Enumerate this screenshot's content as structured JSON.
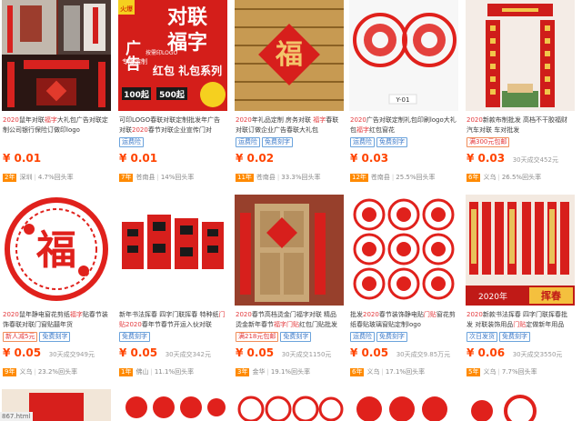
{
  "status_url": "867.html",
  "products": [
    {
      "title_parts": [
        [
          "2020",
          "hl"
        ],
        [
          "鼠年对联",
          ""
        ],
        [
          "福字",
          "hl"
        ],
        [
          "大礼包广告对联定制公司银行保险订做印logo",
          ""
        ]
      ],
      "badges": [],
      "price": "¥ 0.01",
      "sales": "",
      "years": "2年",
      "location": "深圳",
      "rate": "4.7%回头率"
    },
    {
      "title_parts": [
        [
          "可印LOGO春联对联定制批发年广告对联",
          ""
        ],
        [
          "2020",
          "hl"
        ],
        [
          "春节对联企业宣传门对",
          ""
        ]
      ],
      "badges": [
        [
          "运费险",
          "blue"
        ]
      ],
      "price": "¥ 0.01",
      "sales": "",
      "years": "7年",
      "location": "苍南县",
      "rate": "14%回头率"
    },
    {
      "title_parts": [
        [
          "2020",
          "hl"
        ],
        [
          "年礼品定制 房务对联 ",
          ""
        ],
        [
          "福字",
          "hl"
        ],
        [
          "春联对联订做企业广告春联大礼包",
          ""
        ]
      ],
      "badges": [
        [
          "运费险",
          "blue"
        ],
        [
          "免费刻字",
          "blue"
        ]
      ],
      "price": "¥ 0.02",
      "sales": "",
      "years": "11年",
      "location": "苍南县",
      "rate": "33.3%回头率"
    },
    {
      "title_parts": [
        [
          "2020",
          "hl"
        ],
        [
          "广告对联定制礼包印刷logo大礼包",
          ""
        ],
        [
          "福字",
          "hl"
        ],
        [
          "红包窗花",
          ""
        ]
      ],
      "badges": [
        [
          "运费险",
          "blue"
        ],
        [
          "免费刻字",
          "blue"
        ]
      ],
      "price": "¥ 0.03",
      "sales": "",
      "years": "12年",
      "location": "苍南县",
      "rate": "25.5%回头率"
    },
    {
      "title_parts": [
        [
          "2020",
          "hl"
        ],
        [
          "新款布制批发 高档不干胶福财汽车对联 车对批发",
          ""
        ]
      ],
      "badges": [
        [
          "满300元包邮",
          "red"
        ]
      ],
      "price": "¥ 0.03",
      "sales": "30天成交452元",
      "years": "6年",
      "location": "义乌",
      "rate": "26.5%回头率"
    },
    {
      "title_parts": [
        [
          "2020",
          "hl"
        ],
        [
          "鼠年静电窗花剪纸",
          ""
        ],
        [
          "福字",
          "hl"
        ],
        [
          "贴春节装饰春联对联门窗贴囍年货",
          ""
        ]
      ],
      "badges": [
        [
          "新人减5元",
          "red"
        ],
        [
          "免费刻字",
          "blue"
        ]
      ],
      "price": "¥ 0.05",
      "sales": "30天成交949元",
      "years": "9年",
      "location": "义乌",
      "rate": "23.2%回头率"
    },
    {
      "title_parts": [
        [
          "新年书法挥春 四字门联挥春 特种纸",
          ""
        ],
        [
          "门贴",
          "hl"
        ],
        [
          "2020",
          "hl"
        ],
        [
          "春年节春节开运入伙对联",
          ""
        ]
      ],
      "badges": [
        [
          "免费刻字",
          "blue"
        ]
      ],
      "price": "¥ 0.05",
      "sales": "30天成交342元",
      "years": "1年",
      "location": "佛山",
      "rate": "11.1%回头率"
    },
    {
      "title_parts": [
        [
          "2020",
          "hl"
        ],
        [
          "春节高档烫金门福字对联 精品烫金新年春节",
          ""
        ],
        [
          "福字门贴",
          "hl"
        ],
        [
          "红包门贴批发",
          ""
        ]
      ],
      "badges": [
        [
          "满218元包邮",
          "red"
        ],
        [
          "免费刻字",
          "blue"
        ]
      ],
      "price": "¥ 0.05",
      "sales": "30天成交1150元",
      "years": "3年",
      "location": "金华",
      "rate": "19.1%回头率"
    },
    {
      "title_parts": [
        [
          "批发",
          ""
        ],
        [
          "2020",
          "hl"
        ],
        [
          "春节装饰静电贴",
          ""
        ],
        [
          "门贴",
          "hl"
        ],
        [
          "窗花剪纸春贴玻璃窗贴定制logo",
          ""
        ]
      ],
      "badges": [
        [
          "运费险",
          "blue"
        ],
        [
          "免费刻字",
          "blue"
        ]
      ],
      "price": "¥ 0.05",
      "sales": "30天成交9.85万元",
      "years": "6年",
      "location": "义乌",
      "rate": "17.1%回头率"
    },
    {
      "title_parts": [
        [
          "2020",
          "hl"
        ],
        [
          "新款书法挥春 四字门联挥春批发 对联装饰用品",
          ""
        ],
        [
          "门贴",
          "hl"
        ],
        [
          "定做新年用品",
          ""
        ]
      ],
      "badges": [
        [
          "次日发货",
          "blue"
        ],
        [
          "免费刻字",
          "blue"
        ]
      ],
      "price": "¥ 0.06",
      "sales": "30天成交3550元",
      "years": "5年",
      "location": "义乌",
      "rate": "7.7%回头率"
    }
  ],
  "thumb_text": {
    "ad_line1": "对联",
    "ad_line2": "福字",
    "ad_line3": "红包 礼包系列",
    "ad_side": "广告",
    "ad_small": "按需印LOGO",
    "ad_badge": "专版定制",
    "ad_price1": "100起",
    "ad_price2": "500起",
    "ad_stamp": "火爆",
    "fu": "福",
    "y01": "Y-01",
    "year2020": "2020年",
    "huichun": "挥春"
  }
}
